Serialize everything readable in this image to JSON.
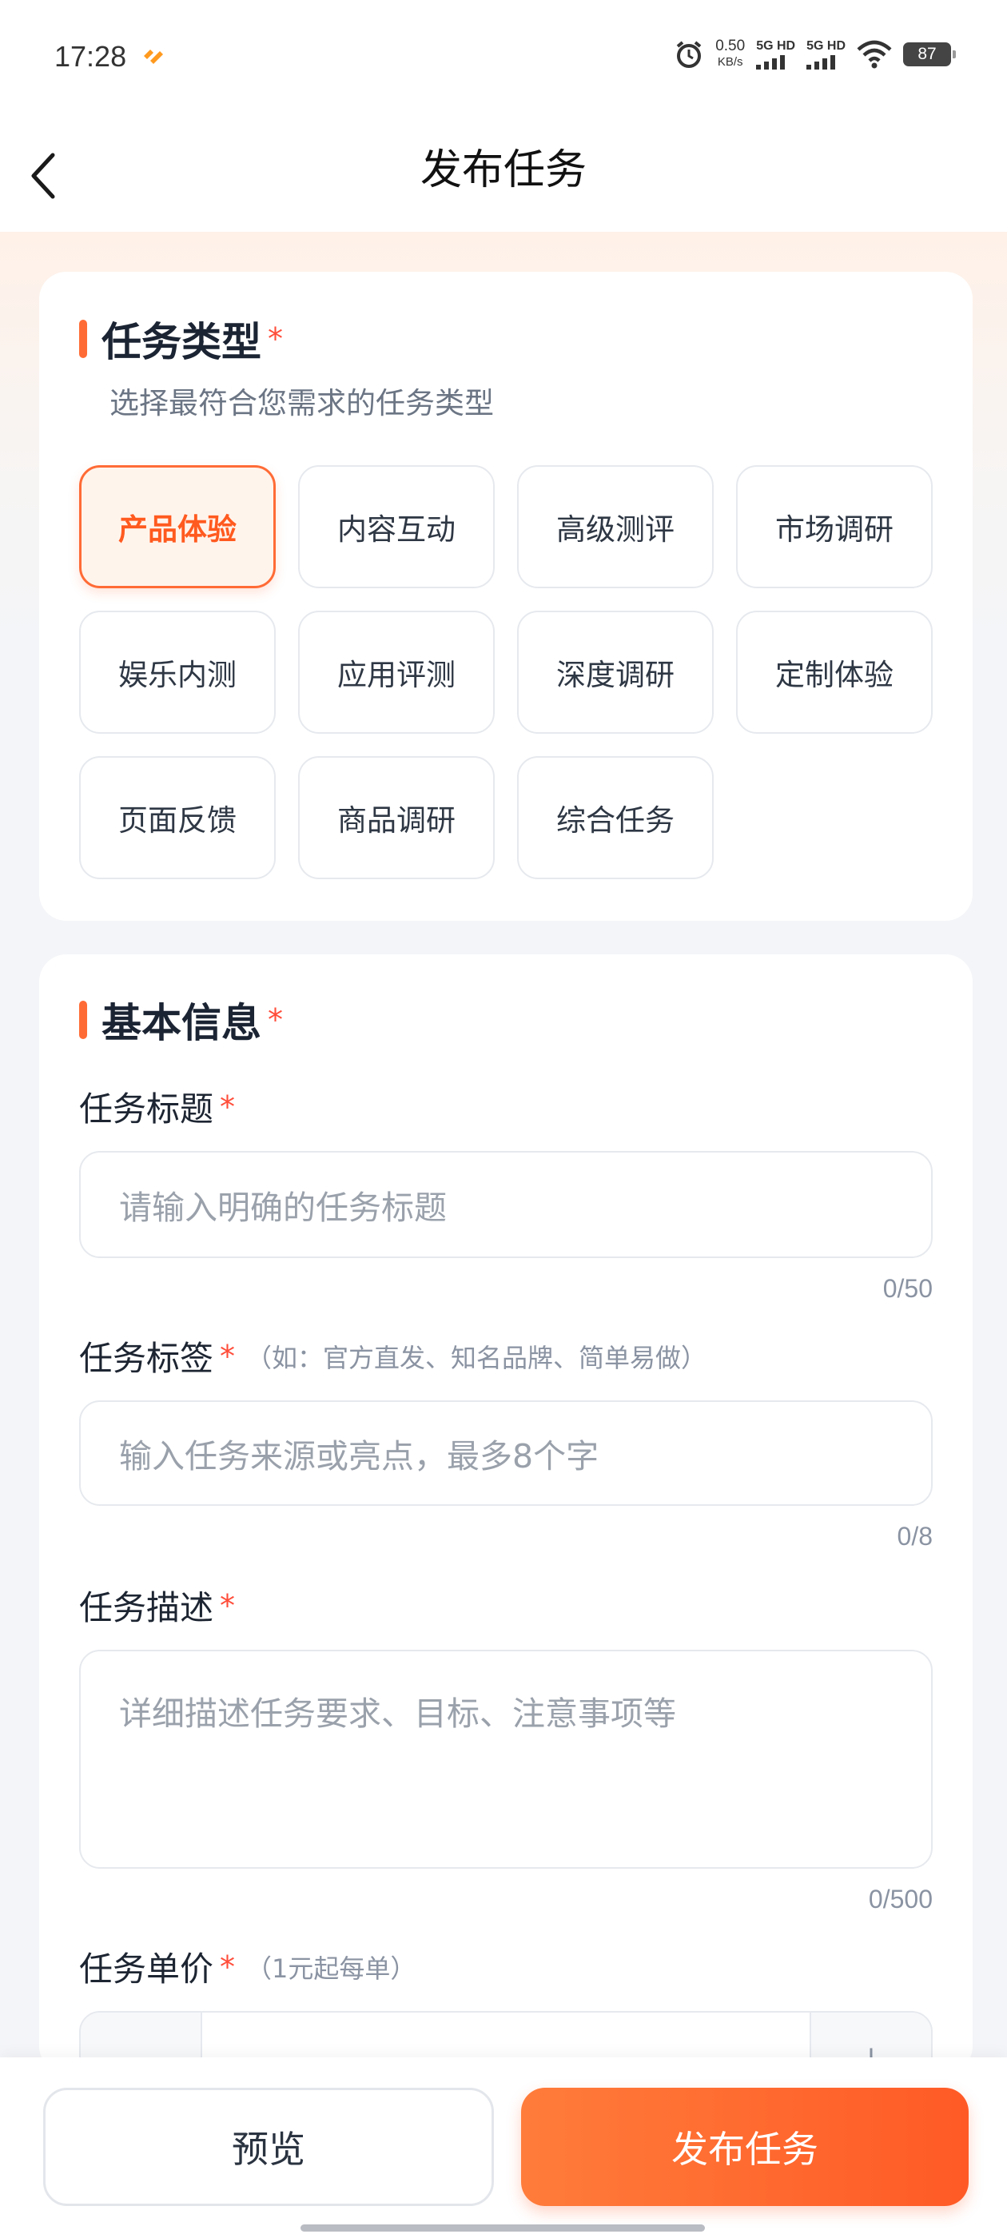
{
  "status_bar": {
    "time": "17:28",
    "net_speed_value": "0.50",
    "net_speed_unit": "KB/s",
    "sim1": "5G HD",
    "sim2": "5G HD",
    "battery": "87",
    "icons": [
      "brand-icon",
      "alarm-icon",
      "signal-icon",
      "wifi-icon",
      "battery-icon"
    ]
  },
  "nav": {
    "title": "发布任务",
    "back_icon": "chevron-left-icon"
  },
  "task_type": {
    "title": "任务类型",
    "required_mark": "*",
    "subtitle": "选择最符合您需求的任务类型",
    "selected": "产品体验",
    "options": [
      "产品体验",
      "内容互动",
      "高级测评",
      "市场调研",
      "娱乐内测",
      "应用评测",
      "深度调研",
      "定制体验",
      "页面反馈",
      "商品调研",
      "综合任务"
    ]
  },
  "basic_info": {
    "title": "基本信息",
    "required_mark": "*",
    "task_title": {
      "label": "任务标题",
      "placeholder": "请输入明确的任务标题",
      "counter": "0/50"
    },
    "task_tag": {
      "label": "任务标签",
      "hint": "（如：官方直发、知名品牌、简单易做）",
      "placeholder": "输入任务来源或亮点，最多8个字",
      "counter": "0/8"
    },
    "task_desc": {
      "label": "任务描述",
      "placeholder": "详细描述任务要求、目标、注意事项等",
      "counter": "0/500"
    },
    "task_price": {
      "label": "任务单价",
      "hint": "（1元起每单）",
      "decrease": "－",
      "increase": "＋"
    }
  },
  "actions": {
    "preview": "预览",
    "publish": "发布任务"
  },
  "colors": {
    "accent": "#ff6b35",
    "required": "#ff4d3a"
  }
}
